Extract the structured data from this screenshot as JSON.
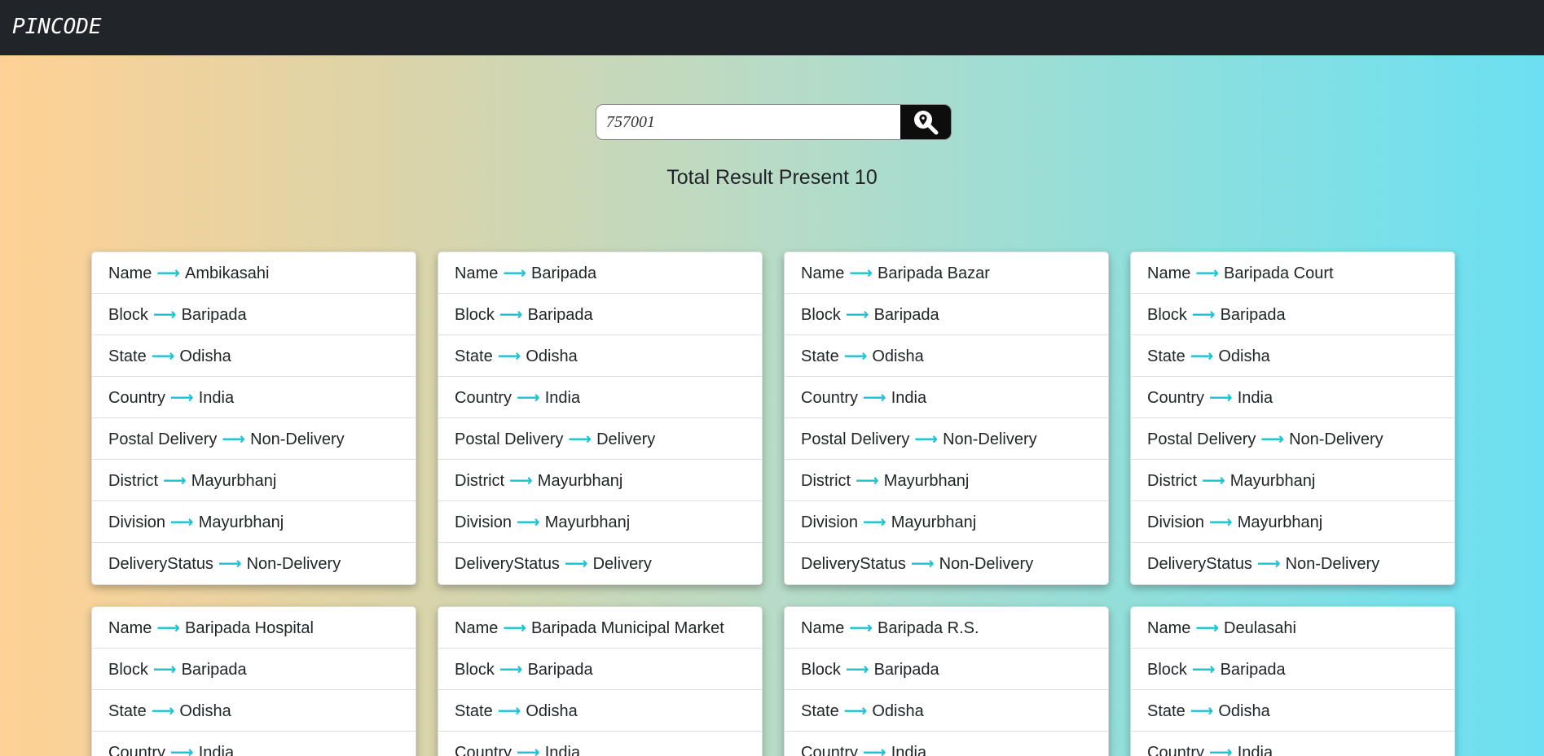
{
  "app": {
    "brand": "PINCODE"
  },
  "search": {
    "value": "757001",
    "button_icon": "map-pin-search-icon"
  },
  "summary": {
    "label": "Total Result Present",
    "count": "10"
  },
  "arrow_glyph": "⟶",
  "colors": {
    "navbar": "#212529",
    "accent_arrow": "#17c3d4",
    "search_button": "#0d0d0d"
  },
  "labels": {
    "name": "Name",
    "block": "Block",
    "state": "State",
    "country": "Country",
    "postal_delivery": "Postal Delivery",
    "district": "District",
    "division": "Division",
    "delivery_status": "DeliveryStatus"
  },
  "results": [
    {
      "name": "Ambikasahi",
      "block": "Baripada",
      "state": "Odisha",
      "country": "India",
      "postal_delivery": "Non-Delivery",
      "district": "Mayurbhanj",
      "division": "Mayurbhanj",
      "delivery_status": "Non-Delivery"
    },
    {
      "name": "Baripada",
      "block": "Baripada",
      "state": "Odisha",
      "country": "India",
      "postal_delivery": "Delivery",
      "district": "Mayurbhanj",
      "division": "Mayurbhanj",
      "delivery_status": "Delivery"
    },
    {
      "name": "Baripada Bazar",
      "block": "Baripada",
      "state": "Odisha",
      "country": "India",
      "postal_delivery": "Non-Delivery",
      "district": "Mayurbhanj",
      "division": "Mayurbhanj",
      "delivery_status": "Non-Delivery"
    },
    {
      "name": "Baripada Court",
      "block": "Baripada",
      "state": "Odisha",
      "country": "India",
      "postal_delivery": "Non-Delivery",
      "district": "Mayurbhanj",
      "division": "Mayurbhanj",
      "delivery_status": "Non-Delivery"
    },
    {
      "name": "Baripada Hospital",
      "block": "Baripada",
      "state": "Odisha",
      "country": "India"
    },
    {
      "name": "Baripada Municipal Market",
      "block": "Baripada",
      "state": "Odisha",
      "country": "India"
    },
    {
      "name": "Baripada R.S.",
      "block": "Baripada",
      "state": "Odisha",
      "country": "India"
    },
    {
      "name": "Deulasahi",
      "block": "Baripada",
      "state": "Odisha",
      "country": "India"
    }
  ]
}
